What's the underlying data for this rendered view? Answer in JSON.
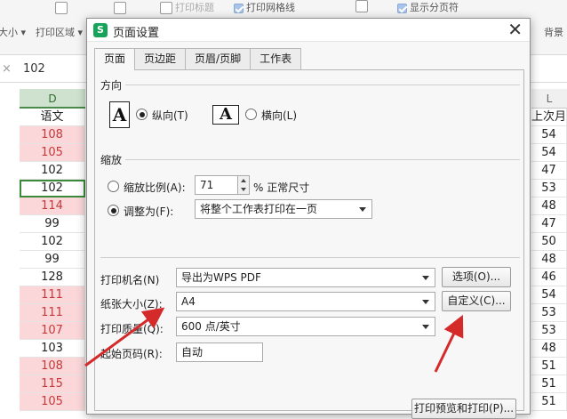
{
  "ribbon": {
    "paper_size": "大小",
    "print_area": "打印区域",
    "print_titles": "打印标题",
    "print_gridlines": "打印网格线",
    "show_page_breaks": "显示分页符",
    "background": "背景"
  },
  "formula_bar": {
    "value": "102"
  },
  "columns": {
    "d": "D",
    "l": "L"
  },
  "col_d": {
    "header": "语文",
    "cells": [
      {
        "v": "108",
        "pink": true
      },
      {
        "v": "105",
        "pink": true
      },
      {
        "v": "102",
        "pink": false
      },
      {
        "v": "102",
        "pink": false,
        "active": true
      },
      {
        "v": "114",
        "pink": true
      },
      {
        "v": "99",
        "pink": false
      },
      {
        "v": "102",
        "pink": false
      },
      {
        "v": "99",
        "pink": false
      },
      {
        "v": "128",
        "pink": false
      },
      {
        "v": "111",
        "pink": true
      },
      {
        "v": "111",
        "pink": true
      },
      {
        "v": "107",
        "pink": true
      },
      {
        "v": "103",
        "pink": false
      },
      {
        "v": "108",
        "pink": true
      },
      {
        "v": "115",
        "pink": true
      },
      {
        "v": "105",
        "pink": true
      }
    ]
  },
  "col_l": {
    "header": "上次月",
    "cells": [
      "54",
      "54",
      "47",
      "53",
      "48",
      "47",
      "50",
      "48",
      "46",
      "54",
      "53",
      "53",
      "48",
      "51",
      "51",
      "51"
    ]
  },
  "dialog": {
    "title": "页面设置",
    "app_icon": "S",
    "tabs": [
      "页面",
      "页边距",
      "页眉/页脚",
      "工作表"
    ],
    "orientation": {
      "label": "方向",
      "portrait": "纵向(T)",
      "landscape": "横向(L)",
      "selected": "portrait"
    },
    "scaling": {
      "label": "缩放",
      "scale_label": "缩放比例(A):",
      "scale_value": "71",
      "scale_suffix": "% 正常尺寸",
      "fit_label": "调整为(F):",
      "fit_value": "将整个工作表打印在一页",
      "selected": "fit"
    },
    "printer": {
      "label": "打印机名(N)",
      "value": "导出为WPS PDF",
      "button": "选项(O)..."
    },
    "paper": {
      "label": "纸张大小(Z):",
      "value": "A4",
      "button": "自定义(C)..."
    },
    "quality": {
      "label": "打印质量(Q):",
      "value": "600 点/英寸"
    },
    "first_page": {
      "label": "起始页码(R):",
      "value": "自动"
    },
    "preview_button": "打印预览和打印(P)..."
  },
  "colors": {
    "pink_fill": "#fbd7d9",
    "pink_text": "#c23a3a",
    "active_green": "#3a8a3a",
    "arrow_red": "#d42a2a",
    "wps_green": "#17a45a"
  },
  "icons": [
    "close-icon",
    "radio-icon",
    "dropdown-caret-icon",
    "spinner-icon",
    "portrait-page-icon",
    "landscape-page-icon",
    "red-arrow-icon"
  ]
}
